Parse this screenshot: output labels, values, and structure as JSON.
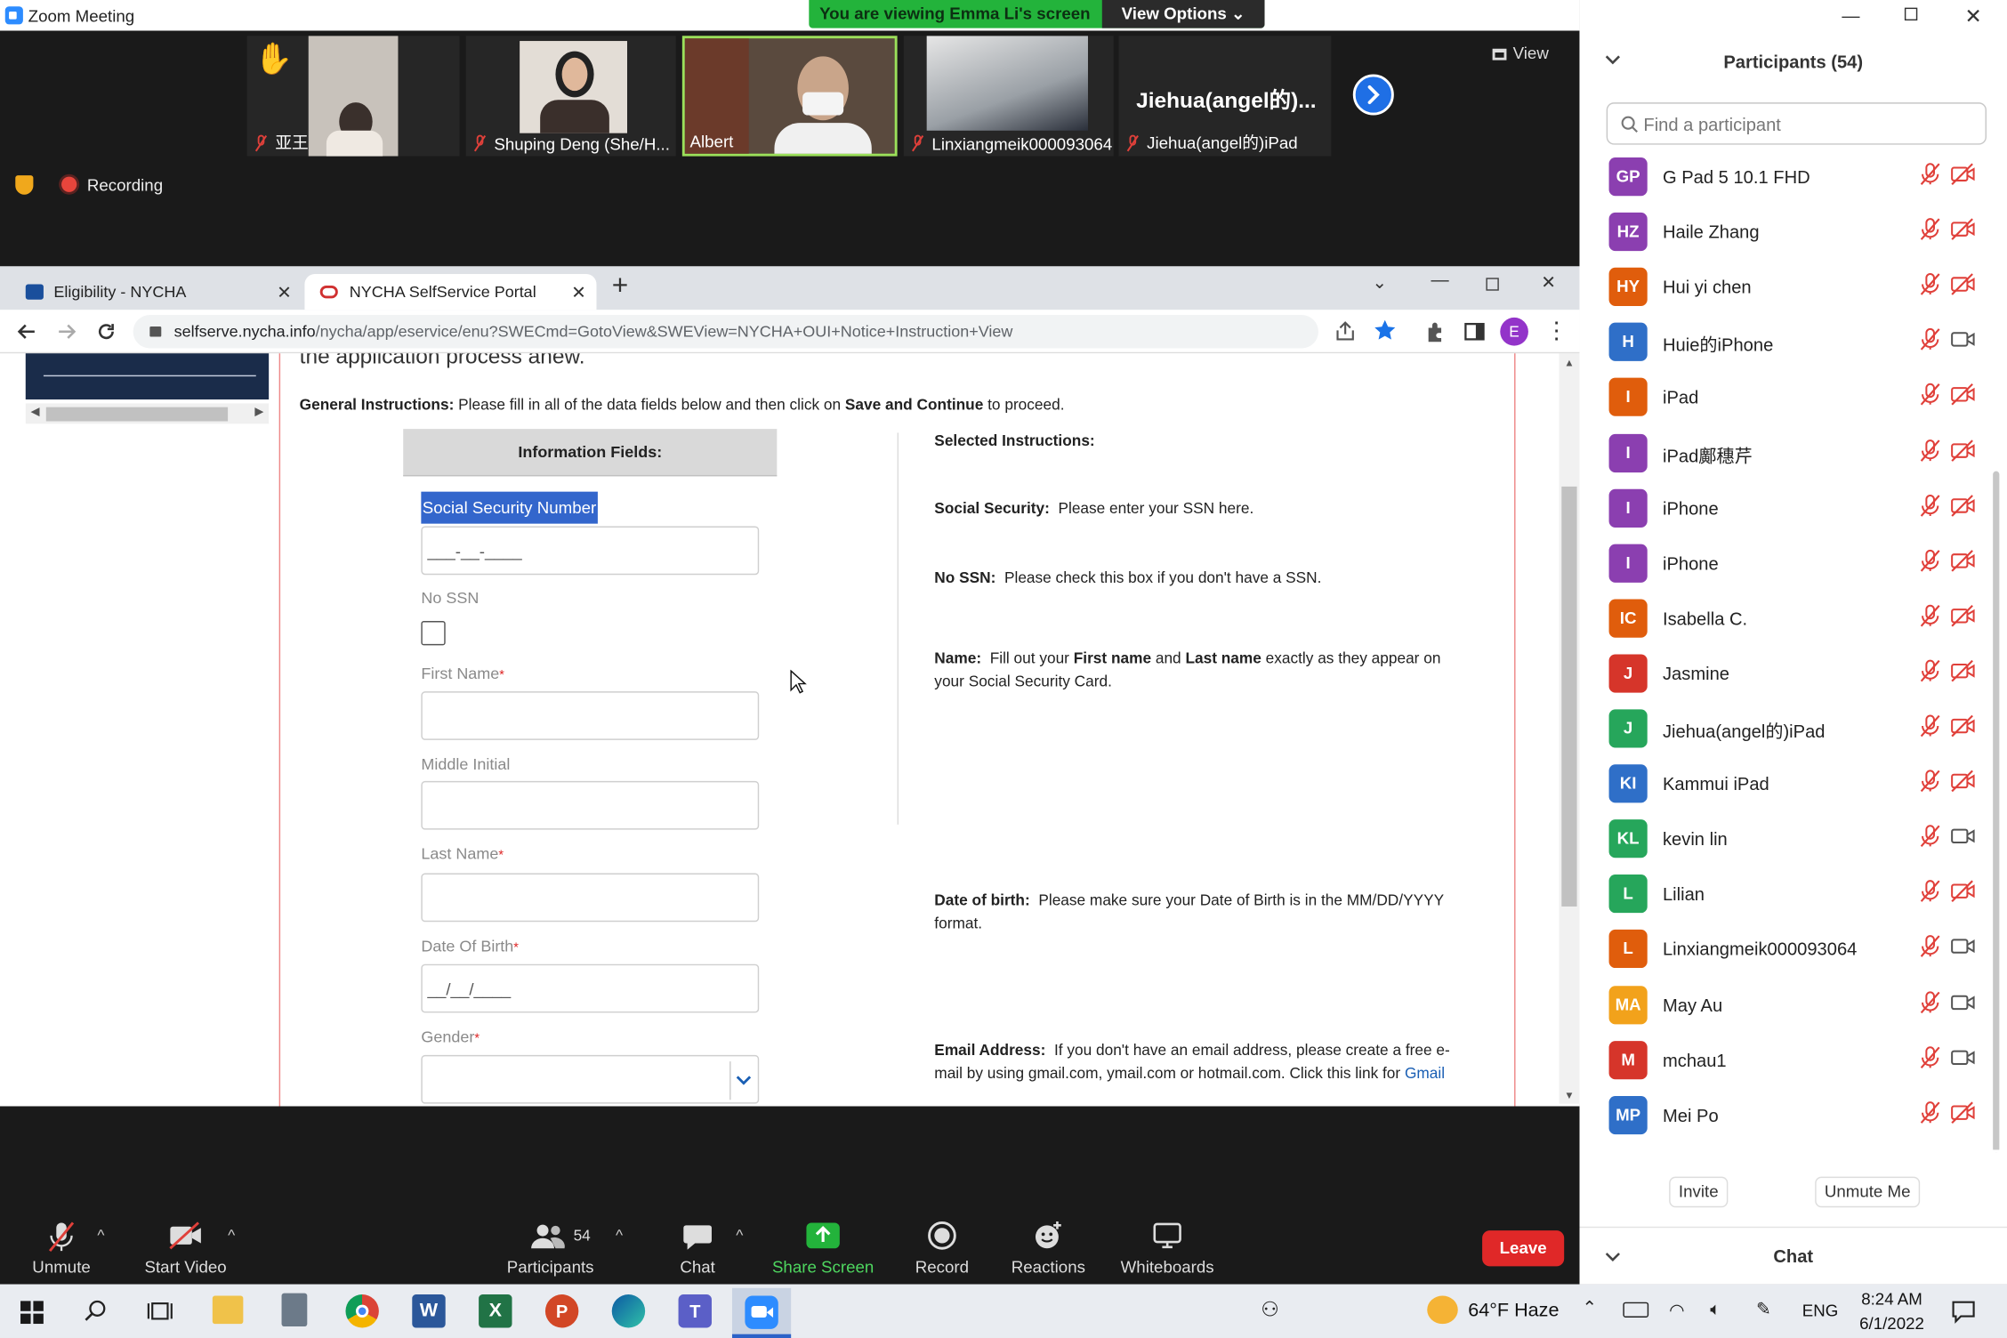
{
  "zoom": {
    "window_title": "Zoom Meeting",
    "viewing_banner": "You are viewing Emma Li's screen",
    "view_options": "View Options",
    "view_button": "View",
    "recording": "Recording",
    "videos": [
      {
        "name": "亚王",
        "muted": true,
        "raised_hand": true
      },
      {
        "name": "Shuping Deng (She/H...",
        "muted": true
      },
      {
        "name": "Albert",
        "muted": false,
        "active_speaker": true
      },
      {
        "name": "Linxiangmeik000093064",
        "muted": true
      },
      {
        "name": "Jiehua(angel的)iPad",
        "muted": true,
        "display_name": "Jiehua(angel的)..."
      }
    ]
  },
  "browser": {
    "tabs": [
      {
        "title": "Eligibility - NYCHA",
        "active": false
      },
      {
        "title": "NYCHA SelfService Portal",
        "active": true
      }
    ],
    "url_host": "selfserve.nycha.info",
    "url_rest": "/nycha/app/eservice/enu?SWECmd=GotoView&SWEView=NYCHA+OUI+Notice+Instruction+View",
    "profile_initial": "E"
  },
  "page": {
    "truncated_header": "the application process anew.",
    "general_prefix": "General Instructions:",
    "general_text": " Please fill in all of the data fields below and then click on ",
    "general_bold": "Save and Continue",
    "general_suffix": " to proceed.",
    "info_fields_header": "Information Fields:",
    "ssn_label": "Social Security Number",
    "ssn_placeholder": "___-__-____",
    "no_ssn_label": "No SSN",
    "first_name_label": "First Name",
    "middle_initial_label": "Middle Initial",
    "last_name_label": "Last Name",
    "dob_label": "Date Of Birth",
    "dob_placeholder": "__/__/____",
    "gender_label": "Gender",
    "required_marker": "*",
    "selected_instructions": "Selected Instructions:",
    "instr_ssn_title": "Social Security:",
    "instr_ssn_text": "Please enter your SSN here.",
    "instr_nossn_title": "No SSN:",
    "instr_nossn_text": "Please check this box if you don't have a SSN.",
    "instr_name_title": "Name:",
    "instr_name_text1": "Fill out your ",
    "instr_name_bold1": "First name",
    "instr_name_text2": " and ",
    "instr_name_bold2": "Last name",
    "instr_name_text3": " exactly as they appear on",
    "instr_name_line2": "your Social Security Card.",
    "instr_dob_title": "Date of birth:",
    "instr_dob_text": "Please make sure your Date of Birth is in the MM/DD/YYYY",
    "instr_dob_line2": "format.",
    "instr_email_title": "Email Address:",
    "instr_email_text": "If you don't have an email address, please create a free e-",
    "instr_email_line2": "mail by using gmail.com, ymail.com or hotmail.com. Click this link for ",
    "instr_email_link": "Gmail"
  },
  "participants": {
    "title": "Participants (54)",
    "search_placeholder": "Find a participant",
    "list": [
      {
        "initials": "GP",
        "name": "G Pad 5 10.1 FHD",
        "color": "#8b3fb0",
        "video_off": true
      },
      {
        "initials": "HZ",
        "name": "Haile Zhang",
        "color": "#8b3fb0",
        "video_off": true
      },
      {
        "initials": "HY",
        "name": "Hui yi chen",
        "color": "#e05d0c",
        "video_off": true
      },
      {
        "initials": "H",
        "name": "Huie的iPhone",
        "color": "#2f6fc8",
        "video_off": false
      },
      {
        "initials": "I",
        "name": "iPad",
        "color": "#e05d0c",
        "video_off": true
      },
      {
        "initials": "I",
        "name": "iPad鄺穗芹",
        "color": "#8b3fb0",
        "video_off": true
      },
      {
        "initials": "I",
        "name": "iPhone",
        "color": "#8b3fb0",
        "video_off": true
      },
      {
        "initials": "I",
        "name": "iPhone",
        "color": "#8b3fb0",
        "video_off": true
      },
      {
        "initials": "IC",
        "name": "Isabella C.",
        "color": "#e05d0c",
        "video_off": true
      },
      {
        "initials": "J",
        "name": "Jasmine",
        "color": "#d6352a",
        "video_off": true
      },
      {
        "initials": "J",
        "name": "Jiehua(angel的)iPad",
        "color": "#26a65b",
        "video_off": true
      },
      {
        "initials": "KI",
        "name": "Kammui iPad",
        "color": "#2f6fc8",
        "video_off": true
      },
      {
        "initials": "KL",
        "name": "kevin lin",
        "color": "#26a65b",
        "video_off": false
      },
      {
        "initials": "L",
        "name": "Lilian",
        "color": "#26a65b",
        "video_off": true
      },
      {
        "initials": "L",
        "name": "Linxiangmeik000093064",
        "color": "#e05d0c",
        "video_off": false
      },
      {
        "initials": "MA",
        "name": "May Au",
        "color": "#f2a21b",
        "video_off": false
      },
      {
        "initials": "M",
        "name": "mchau1",
        "color": "#d6352a",
        "video_off": false
      },
      {
        "initials": "MP",
        "name": "Mei Po",
        "color": "#2f6fc8",
        "video_off": true
      }
    ],
    "invite": "Invite",
    "unmute_me": "Unmute Me",
    "chat": "Chat"
  },
  "toolbar": {
    "unmute": "Unmute",
    "start_video": "Start Video",
    "participants": "Participants",
    "participants_count": "54",
    "chat": "Chat",
    "share_screen": "Share Screen",
    "record": "Record",
    "reactions": "Reactions",
    "whiteboards": "Whiteboards",
    "leave": "Leave"
  },
  "taskbar": {
    "weather": "64°F  Haze",
    "lang": "ENG",
    "time": "8:24 AM",
    "date": "6/1/2022"
  },
  "colors": {
    "zoom_green": "#23b33b",
    "zoom_blue": "#1f6fe5",
    "leave_red": "#e02828",
    "ssn_highlight": "#3366cc"
  }
}
